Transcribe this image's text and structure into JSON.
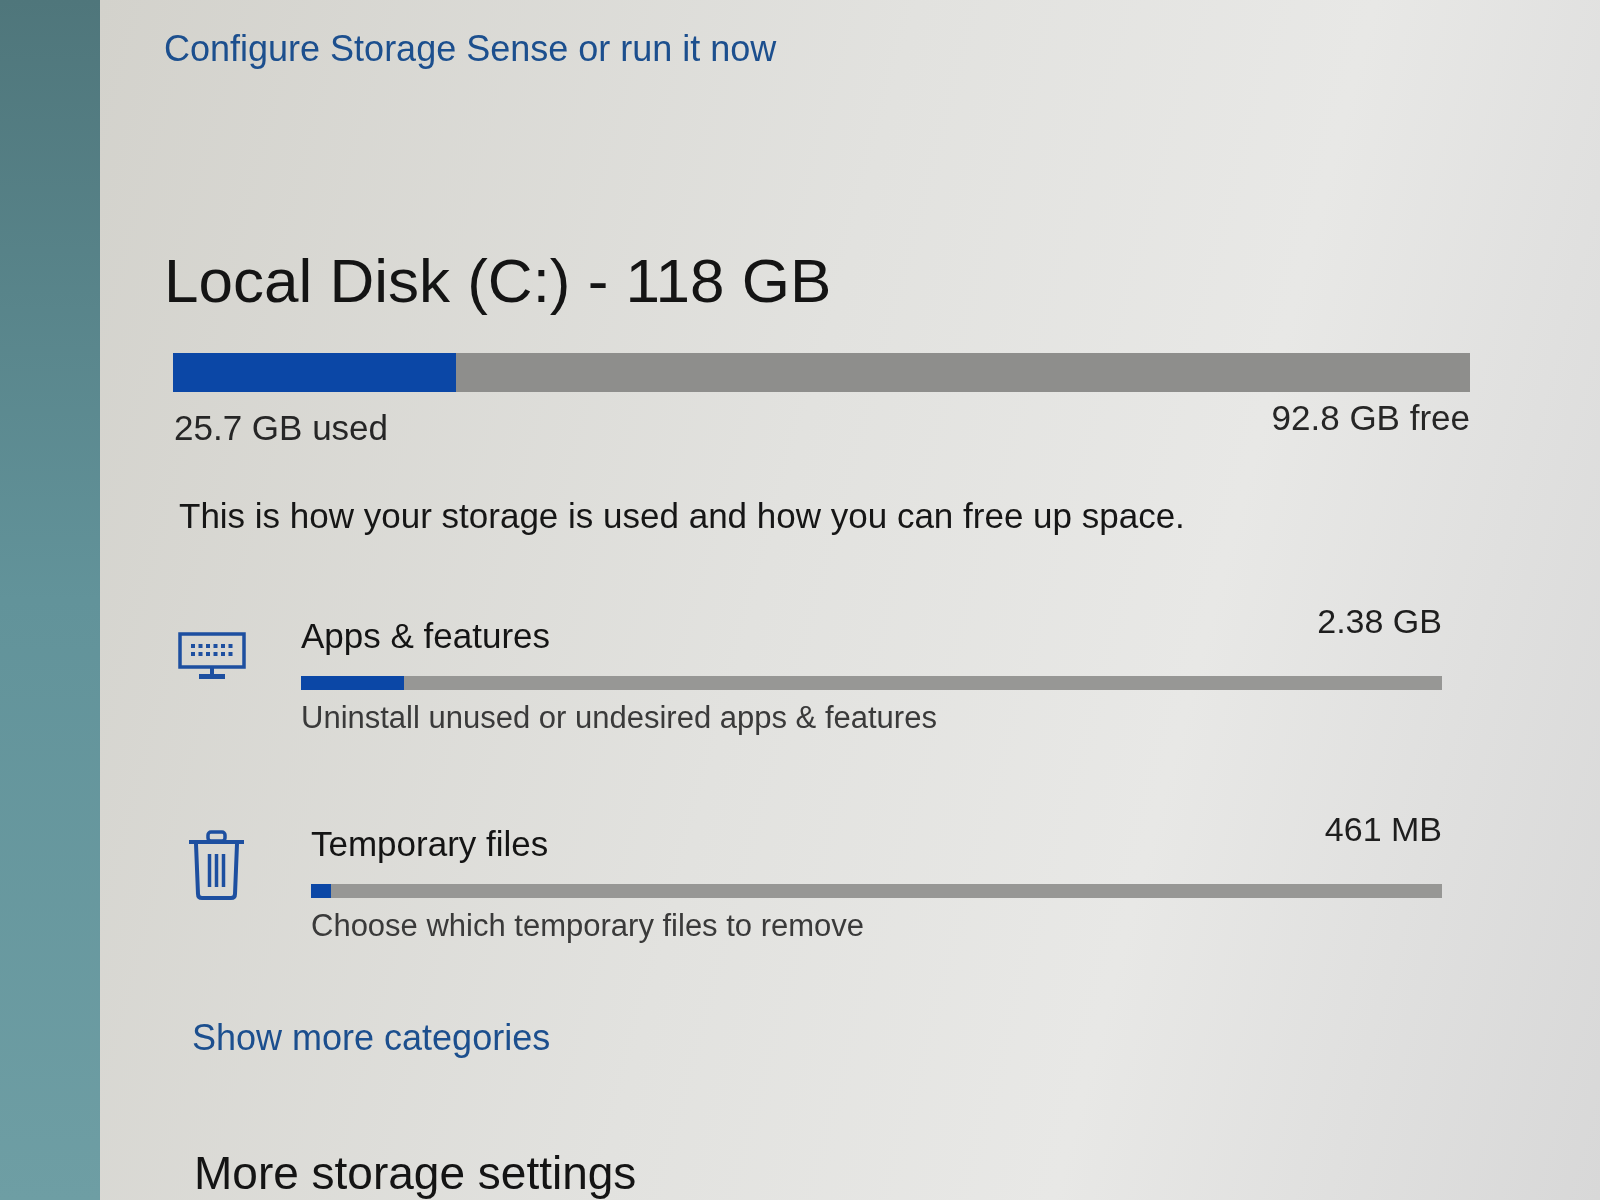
{
  "storage_sense_link": "Configure Storage Sense or run it now",
  "drive": {
    "title": "Local Disk (C:) - 118 GB",
    "level": 0.218,
    "used": "25.7 GB used",
    "free": "92.8 GB free"
  },
  "description": "This is how your storage is used and how you can free up space.",
  "categories": [
    {
      "kind": "apps",
      "name": "Apps & features",
      "size": "2.38 GB",
      "level": 0.09,
      "description": "Uninstall unused or undesired apps & features"
    },
    {
      "kind": "temp",
      "name": "Temporary files",
      "size": "461 MB",
      "level": 0.018,
      "description": "Choose which temporary files to remove"
    }
  ],
  "show_more_link": "Show more categories",
  "section_heading": "More storage settings"
}
